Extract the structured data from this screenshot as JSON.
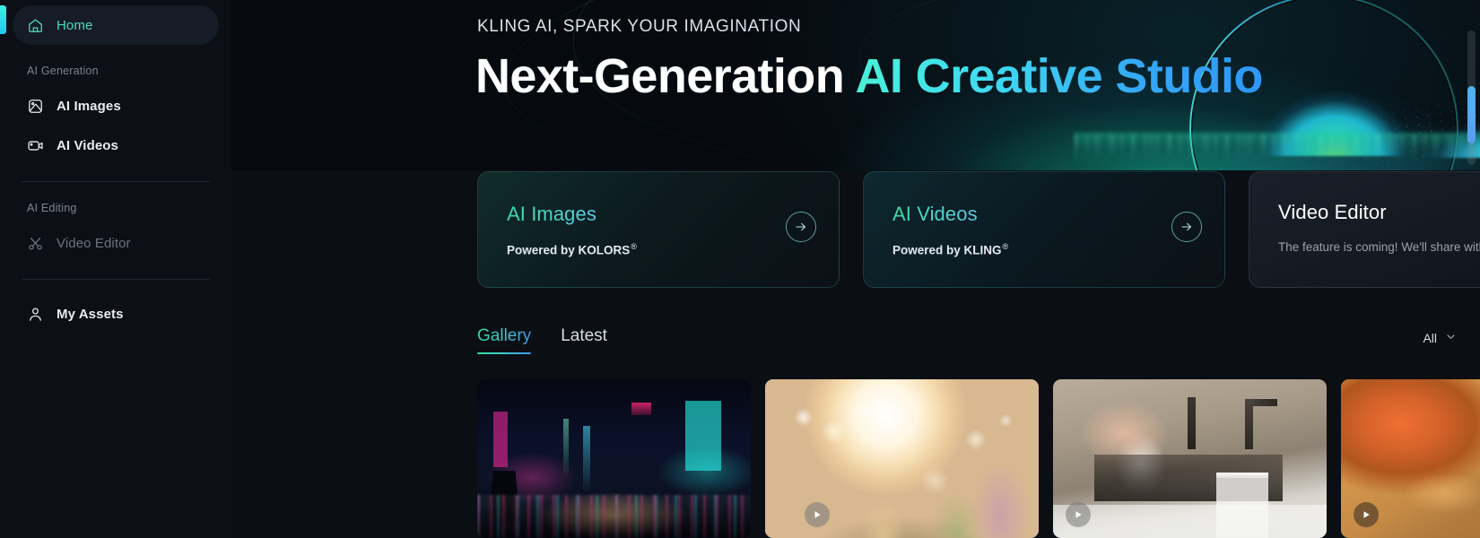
{
  "sidebar": {
    "home": {
      "label": "Home",
      "icon": "home-icon"
    },
    "sections": [
      {
        "label": "AI Generation",
        "items": [
          {
            "label": "AI Images",
            "icon": "image-icon",
            "disabled": false
          },
          {
            "label": "AI Videos",
            "icon": "video-camera-icon",
            "disabled": false
          }
        ]
      },
      {
        "label": "AI Editing",
        "items": [
          {
            "label": "Video Editor",
            "icon": "scissors-icon",
            "disabled": true
          }
        ]
      }
    ],
    "assets": {
      "label": "My Assets",
      "icon": "user-icon"
    }
  },
  "hero": {
    "eyebrow": "KLING AI, SPARK YOUR IMAGINATION",
    "title_plain": "Next-Generation ",
    "title_gradient": "AI Creative Studio"
  },
  "cards": [
    {
      "title": "AI Images",
      "sub_text": "Powered by KOLORS",
      "sub_mark": "®",
      "arrow": "arrow-right-icon",
      "has_arrow": true
    },
    {
      "title": "AI Videos",
      "sub_text": "Powered by KLING",
      "sub_mark": "®",
      "arrow": "arrow-right-icon",
      "has_arrow": true
    },
    {
      "title": "Video Editor",
      "sub_text": "The feature is coming! We'll share with you soon.",
      "sub_mark": "",
      "arrow": "",
      "has_arrow": false
    }
  ],
  "tabs": [
    {
      "label": "Gallery",
      "active": true
    },
    {
      "label": "Latest",
      "active": false
    }
  ],
  "filter": {
    "value": "All",
    "icon": "chevron-down-icon"
  },
  "gallery": [
    {
      "alt": "Neon cityscape at night with illuminated billboards and wet reflective street",
      "has_play": false
    },
    {
      "alt": "Sunlit bokeh nature scene with warm backlight and flowers",
      "has_play": true
    },
    {
      "alt": "Hands pouring milk from a jug into a glass beside a kitchen sink",
      "has_play": true
    },
    {
      "alt": "Fantasy dragon breathing fire amid golden swirling smoke",
      "has_play": true
    }
  ],
  "colors": {
    "accent_cyan": "#3ef0e0",
    "accent_green": "#35d99b",
    "accent_blue": "#3f9ae8",
    "page_bg": "#0b0e13",
    "sidebar_bg": "#0c0f15",
    "active_nav": "#4ddbc4"
  }
}
